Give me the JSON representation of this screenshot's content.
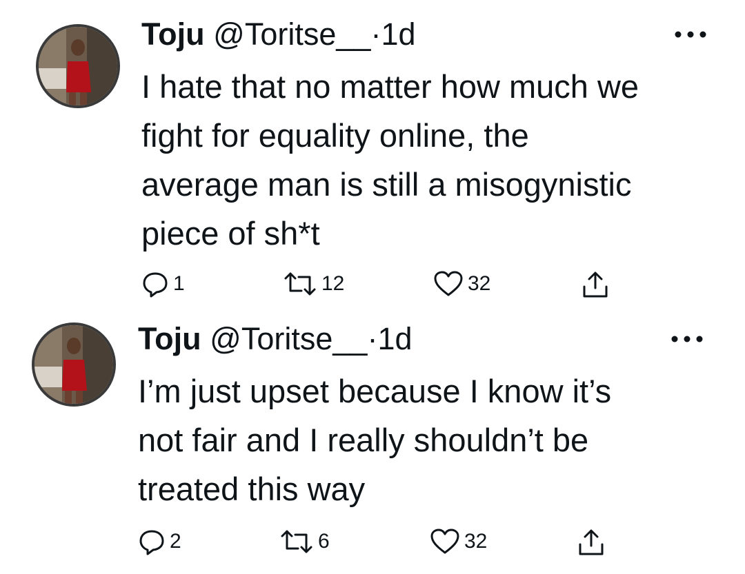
{
  "tweets": [
    {
      "name": "Toju",
      "handle": "@Toritse__",
      "separator": "·",
      "time": "1d",
      "text_lines": [
        "I hate that no matter how much we",
        "fight for equality online, the",
        "average man is still a misogynistic",
        "piece of sh*t"
      ],
      "replies": "1",
      "retweets": "12",
      "likes": "32"
    },
    {
      "name": "Toju",
      "handle": "@Toritse__",
      "separator": "·",
      "time": "1d",
      "text_lines": [
        "I’m just upset because I know it’s",
        "not fair and I really shouldn’t be",
        "treated this way"
      ],
      "replies": "2",
      "retweets": "6",
      "likes": "32"
    }
  ],
  "icons": {
    "reply": "reply-icon",
    "retweet": "retweet-icon",
    "like": "heart-icon",
    "share": "share-icon",
    "more": "more-options-icon"
  }
}
